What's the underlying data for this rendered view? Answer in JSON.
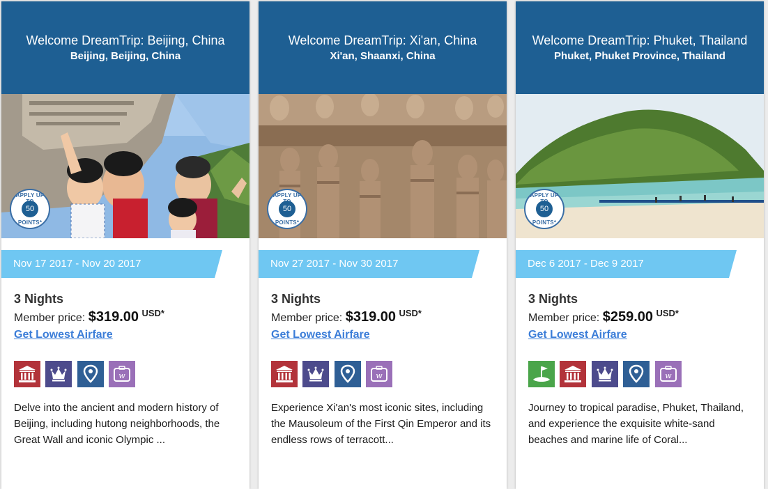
{
  "colors": {
    "header": "#1e5f93",
    "date_band": "#6fc7f2",
    "link": "#3b7dd8",
    "icon_history": "#b2333a",
    "icon_luxury": "#4d4b8c",
    "icon_location": "#2f5f95",
    "icon_brand": "#9a70b8",
    "icon_golf": "#4aa54a"
  },
  "badge": {
    "top_text": "APPLY UP TO",
    "number": "50",
    "bottom_text": "POINTS*"
  },
  "cards": [
    {
      "title": "Welcome DreamTrip: Beijing, China",
      "location": "Beijing, Beijing, China",
      "dates": "Nov 17 2017 - Nov 20 2017",
      "nights": "3 Nights",
      "price_label": "Member price:",
      "price": "$319.00",
      "currency": "USD*",
      "airfare_link": "Get Lowest Airfare",
      "icons": [
        "history-icon",
        "luxury-crown-icon",
        "location-pin-icon",
        "dreamtrips-brand-icon"
      ],
      "description": "Delve into the ancient and modern history of Beijing, including hutong neighborhoods, the Great Wall and iconic Olympic ..."
    },
    {
      "title": "Welcome DreamTrip: Xi'an, China",
      "location": "Xi'an, Shaanxi, China",
      "dates": "Nov 27 2017 - Nov 30 2017",
      "nights": "3 Nights",
      "price_label": "Member price:",
      "price": "$319.00",
      "currency": "USD*",
      "airfare_link": "Get Lowest Airfare",
      "icons": [
        "history-icon",
        "luxury-crown-icon",
        "location-pin-icon",
        "dreamtrips-brand-icon"
      ],
      "description": "Experience Xi'an's most iconic sites, including the Mausoleum of the First Qin Emperor and its endless rows of terracott..."
    },
    {
      "title": "Welcome DreamTrip: Phuket, Thailand",
      "location": "Phuket, Phuket Province, Thailand",
      "dates": "Dec 6 2017 - Dec 9 2017",
      "nights": "3 Nights",
      "price_label": "Member price:",
      "price": "$259.00",
      "currency": "USD*",
      "airfare_link": "Get Lowest Airfare",
      "icons": [
        "golf-icon",
        "history-icon",
        "luxury-crown-icon",
        "location-pin-icon",
        "dreamtrips-brand-icon"
      ],
      "description": "Journey to tropical paradise, Phuket, Thailand, and experience the exquisite white-sand beaches and marine life of Coral..."
    }
  ]
}
